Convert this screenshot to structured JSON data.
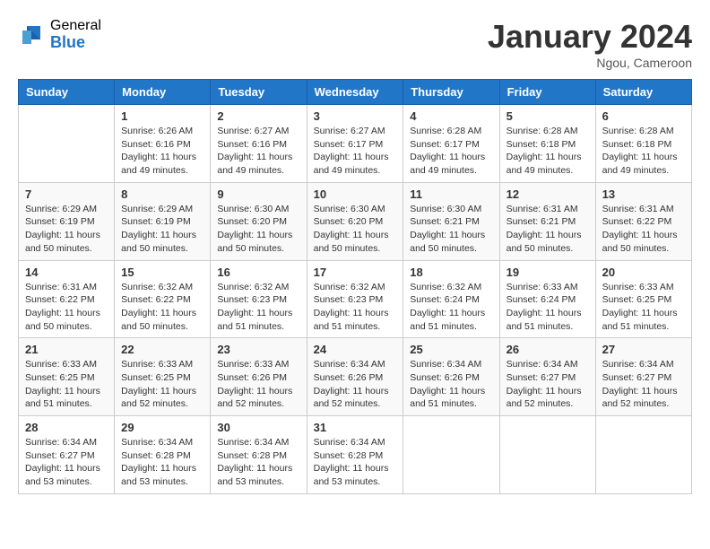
{
  "header": {
    "logo_general": "General",
    "logo_blue": "Blue",
    "month_title": "January 2024",
    "location": "Ngou, Cameroon"
  },
  "weekdays": [
    "Sunday",
    "Monday",
    "Tuesday",
    "Wednesday",
    "Thursday",
    "Friday",
    "Saturday"
  ],
  "weeks": [
    [
      {
        "day": "",
        "info": ""
      },
      {
        "day": "1",
        "info": "Sunrise: 6:26 AM\nSunset: 6:16 PM\nDaylight: 11 hours and 49 minutes."
      },
      {
        "day": "2",
        "info": "Sunrise: 6:27 AM\nSunset: 6:16 PM\nDaylight: 11 hours and 49 minutes."
      },
      {
        "day": "3",
        "info": "Sunrise: 6:27 AM\nSunset: 6:17 PM\nDaylight: 11 hours and 49 minutes."
      },
      {
        "day": "4",
        "info": "Sunrise: 6:28 AM\nSunset: 6:17 PM\nDaylight: 11 hours and 49 minutes."
      },
      {
        "day": "5",
        "info": "Sunrise: 6:28 AM\nSunset: 6:18 PM\nDaylight: 11 hours and 49 minutes."
      },
      {
        "day": "6",
        "info": "Sunrise: 6:28 AM\nSunset: 6:18 PM\nDaylight: 11 hours and 49 minutes."
      }
    ],
    [
      {
        "day": "7",
        "info": "Sunrise: 6:29 AM\nSunset: 6:19 PM\nDaylight: 11 hours and 50 minutes."
      },
      {
        "day": "8",
        "info": "Sunrise: 6:29 AM\nSunset: 6:19 PM\nDaylight: 11 hours and 50 minutes."
      },
      {
        "day": "9",
        "info": "Sunrise: 6:30 AM\nSunset: 6:20 PM\nDaylight: 11 hours and 50 minutes."
      },
      {
        "day": "10",
        "info": "Sunrise: 6:30 AM\nSunset: 6:20 PM\nDaylight: 11 hours and 50 minutes."
      },
      {
        "day": "11",
        "info": "Sunrise: 6:30 AM\nSunset: 6:21 PM\nDaylight: 11 hours and 50 minutes."
      },
      {
        "day": "12",
        "info": "Sunrise: 6:31 AM\nSunset: 6:21 PM\nDaylight: 11 hours and 50 minutes."
      },
      {
        "day": "13",
        "info": "Sunrise: 6:31 AM\nSunset: 6:22 PM\nDaylight: 11 hours and 50 minutes."
      }
    ],
    [
      {
        "day": "14",
        "info": "Sunrise: 6:31 AM\nSunset: 6:22 PM\nDaylight: 11 hours and 50 minutes."
      },
      {
        "day": "15",
        "info": "Sunrise: 6:32 AM\nSunset: 6:22 PM\nDaylight: 11 hours and 50 minutes."
      },
      {
        "day": "16",
        "info": "Sunrise: 6:32 AM\nSunset: 6:23 PM\nDaylight: 11 hours and 51 minutes."
      },
      {
        "day": "17",
        "info": "Sunrise: 6:32 AM\nSunset: 6:23 PM\nDaylight: 11 hours and 51 minutes."
      },
      {
        "day": "18",
        "info": "Sunrise: 6:32 AM\nSunset: 6:24 PM\nDaylight: 11 hours and 51 minutes."
      },
      {
        "day": "19",
        "info": "Sunrise: 6:33 AM\nSunset: 6:24 PM\nDaylight: 11 hours and 51 minutes."
      },
      {
        "day": "20",
        "info": "Sunrise: 6:33 AM\nSunset: 6:25 PM\nDaylight: 11 hours and 51 minutes."
      }
    ],
    [
      {
        "day": "21",
        "info": "Sunrise: 6:33 AM\nSunset: 6:25 PM\nDaylight: 11 hours and 51 minutes."
      },
      {
        "day": "22",
        "info": "Sunrise: 6:33 AM\nSunset: 6:25 PM\nDaylight: 11 hours and 52 minutes."
      },
      {
        "day": "23",
        "info": "Sunrise: 6:33 AM\nSunset: 6:26 PM\nDaylight: 11 hours and 52 minutes."
      },
      {
        "day": "24",
        "info": "Sunrise: 6:34 AM\nSunset: 6:26 PM\nDaylight: 11 hours and 52 minutes."
      },
      {
        "day": "25",
        "info": "Sunrise: 6:34 AM\nSunset: 6:26 PM\nDaylight: 11 hours and 51 minutes."
      },
      {
        "day": "26",
        "info": "Sunrise: 6:34 AM\nSunset: 6:27 PM\nDaylight: 11 hours and 52 minutes."
      },
      {
        "day": "27",
        "info": "Sunrise: 6:34 AM\nSunset: 6:27 PM\nDaylight: 11 hours and 52 minutes."
      }
    ],
    [
      {
        "day": "28",
        "info": "Sunrise: 6:34 AM\nSunset: 6:27 PM\nDaylight: 11 hours and 53 minutes."
      },
      {
        "day": "29",
        "info": "Sunrise: 6:34 AM\nSunset: 6:28 PM\nDaylight: 11 hours and 53 minutes."
      },
      {
        "day": "30",
        "info": "Sunrise: 6:34 AM\nSunset: 6:28 PM\nDaylight: 11 hours and 53 minutes."
      },
      {
        "day": "31",
        "info": "Sunrise: 6:34 AM\nSunset: 6:28 PM\nDaylight: 11 hours and 53 minutes."
      },
      {
        "day": "",
        "info": ""
      },
      {
        "day": "",
        "info": ""
      },
      {
        "day": "",
        "info": ""
      }
    ]
  ]
}
